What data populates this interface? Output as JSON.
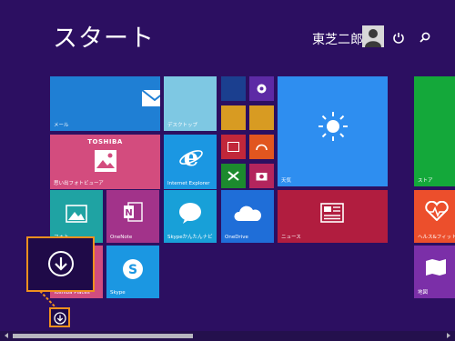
{
  "header": {
    "title": "スタート",
    "user_name": "東芝二郎"
  },
  "tiles": {
    "mail": "メール",
    "desktop": "デスクトップ",
    "photo_brand": "TOSHIBA",
    "photo": "思い出フォトビューア",
    "ie": "Internet Explorer",
    "weather": "天気",
    "store": "ストア",
    "photos": "フォト",
    "onenote": "OneNote",
    "skype_chat": "Skypeかんたんナビ",
    "onedrive": "OneDrive",
    "news": "ニュース",
    "health": "ヘルス&フィットネス",
    "places": "Toshiba Places",
    "skype": "Skype",
    "maps": "地図"
  },
  "colors": {
    "background": "#2c0f61",
    "highlight": "#f0901e",
    "mail": "#1f7fd4",
    "desktop": "#7ec8e3",
    "photo": "#d34c7e",
    "ie": "#1b97e2",
    "weather": "#2e8ef0",
    "store": "#14a83a",
    "news": "#b11d3f"
  }
}
